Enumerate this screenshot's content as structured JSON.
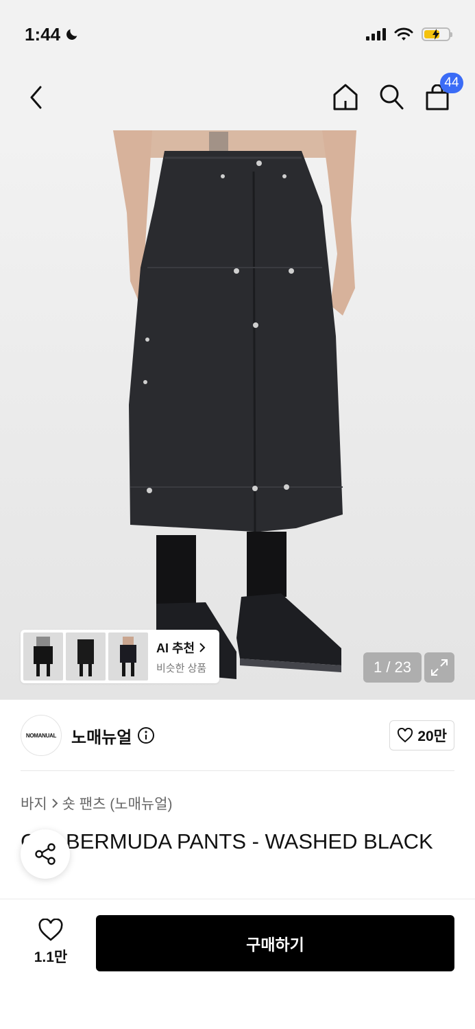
{
  "status": {
    "time": "1:44",
    "icons": [
      "moon-icon",
      "signal-icon",
      "wifi-icon",
      "battery-charging-icon"
    ]
  },
  "header": {
    "icons": [
      "back-icon",
      "home-icon",
      "search-icon",
      "cart-icon"
    ],
    "cart_count": "44"
  },
  "gallery": {
    "page_indicator": "1 / 23",
    "ai_card": {
      "title": "AI 추천",
      "subtitle": "비슷한 상품"
    }
  },
  "brand": {
    "logo_text": "NOMANUAL",
    "name": "노매뉴얼",
    "like_count": "20만"
  },
  "breadcrumb": {
    "category": "바지",
    "subcategory": "숏 팬츠 (노매뉴얼)"
  },
  "product": {
    "title": "CFL BERMUDA PANTS - WASHED BLACK"
  },
  "bottom": {
    "wish_count": "1.1만",
    "buy_label": "구매하기"
  },
  "colors": {
    "accent_badge": "#3b6cf6",
    "buy_button": "#000000",
    "battery": "#f4c20d"
  }
}
